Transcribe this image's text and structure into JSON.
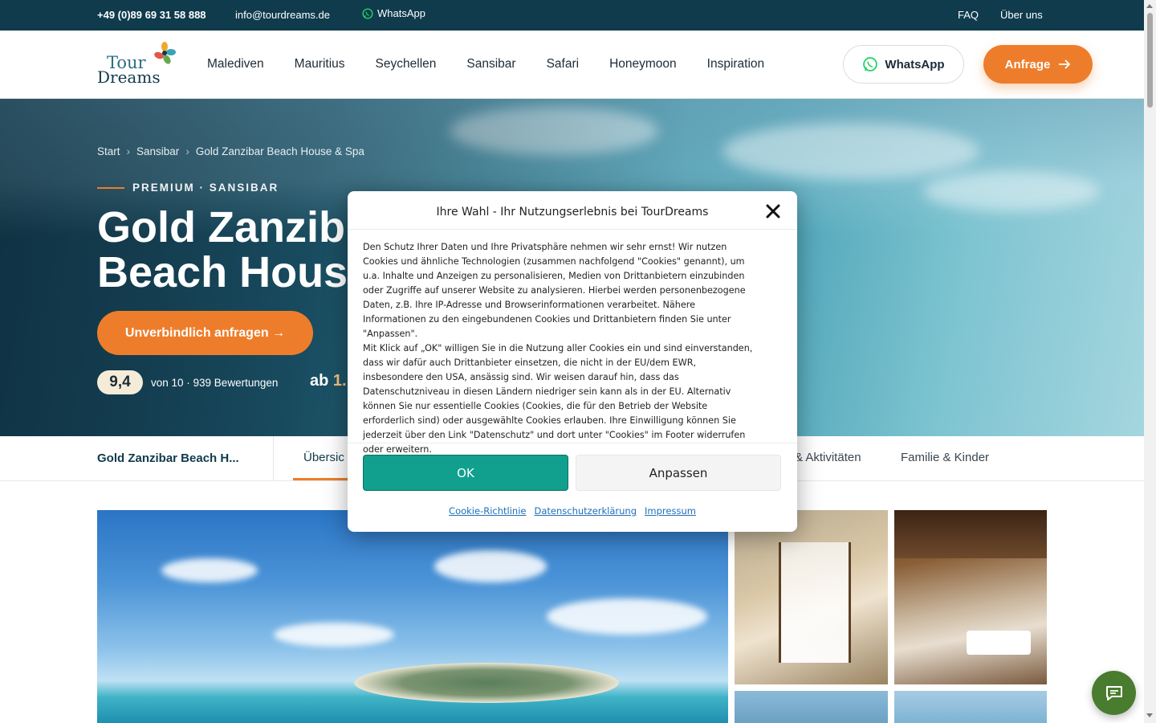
{
  "topbar": {
    "phone": "+49 (0)89 69 31 58 888",
    "email": "info@tourdreams.de",
    "whatsapp": "WhatsApp",
    "faq": "FAQ",
    "about": "Über uns"
  },
  "header": {
    "logo_line1": "Tour",
    "logo_line2": "Dreams",
    "nav": [
      "Malediven",
      "Mauritius",
      "Seychellen",
      "Sansibar",
      "Safari",
      "Honeymoon",
      "Inspiration"
    ],
    "whatsapp_button": "WhatsApp",
    "request_button": "Anfrage"
  },
  "hero": {
    "breadcrumb": [
      "Start",
      "Sansibar",
      "Gold Zanzibar Beach House & Spa"
    ],
    "eyebrow": "PREMIUM · SANSIBAR",
    "title_line1": "Gold Zanzib",
    "title_line2": "Beach Hous",
    "cta": "Unverbindlich anfragen →",
    "rating_score": "9,4",
    "rating_count": "von 10 · 939 Bewertungen",
    "price_prefix": "ab",
    "price_value": "1."
  },
  "subnav": {
    "hotel_name": "Gold Zanzibar Beach H...",
    "tabs": [
      "Übersic",
      "& Aktivitäten",
      "Familie & Kinder"
    ]
  },
  "cookie_modal": {
    "title": "Ihre Wahl - Ihr Nutzungserlebnis bei TourDreams",
    "body_p1": "Den Schutz Ihrer Daten und Ihre Privatsphäre nehmen wir sehr ernst! Wir nutzen Cookies und ähnliche Technologien (zusammen nachfolgend \"Cookies\" genannt), um u.a. Inhalte und Anzeigen zu personalisieren, Medien von Drittanbietern einzubinden oder Zugriffe auf unserer Website zu analysieren. Hierbei werden personenbezogene Daten, z.B. Ihre IP-Adresse und Browserinformationen verarbeitet. Nähere Informationen zu den eingebundenen Cookies und Drittanbietern finden Sie unter \"Anpassen\".",
    "body_p2": "Mit Klick auf „OK\" willigen Sie in die Nutzung aller Cookies ein und sind einverstanden, dass wir dafür auch Drittanbieter einsetzen, die nicht in der EU/dem EWR, insbesondere den USA, ansässig sind. Wir weisen darauf hin, dass das Datenschutzniveau in diesen Ländern niedriger sein kann als in der EU. Alternativ können Sie nur essentielle Cookies (Cookies, die für den Betrieb der Website erforderlich sind) oder ausgewählte Cookies erlauben. Ihre Einwilligung können Sie jederzeit über den Link \"Datenschutz\" und dort unter \"Cookies\" im Footer widerrufen oder erweitern.",
    "ok_button": "OK",
    "customize_button": "Anpassen",
    "links": [
      "Cookie-Richtlinie",
      "Datenschutzerklärung",
      "Impressum"
    ]
  },
  "colors": {
    "topbar": "#0f3b4c",
    "accent": "#ee7d2b",
    "ok_button": "#119f8e",
    "chat": "#4a7c2f"
  },
  "icons": [
    "whatsapp-icon",
    "arrow-right-icon",
    "close-icon",
    "chat-icon",
    "logo-flower-icon"
  ]
}
